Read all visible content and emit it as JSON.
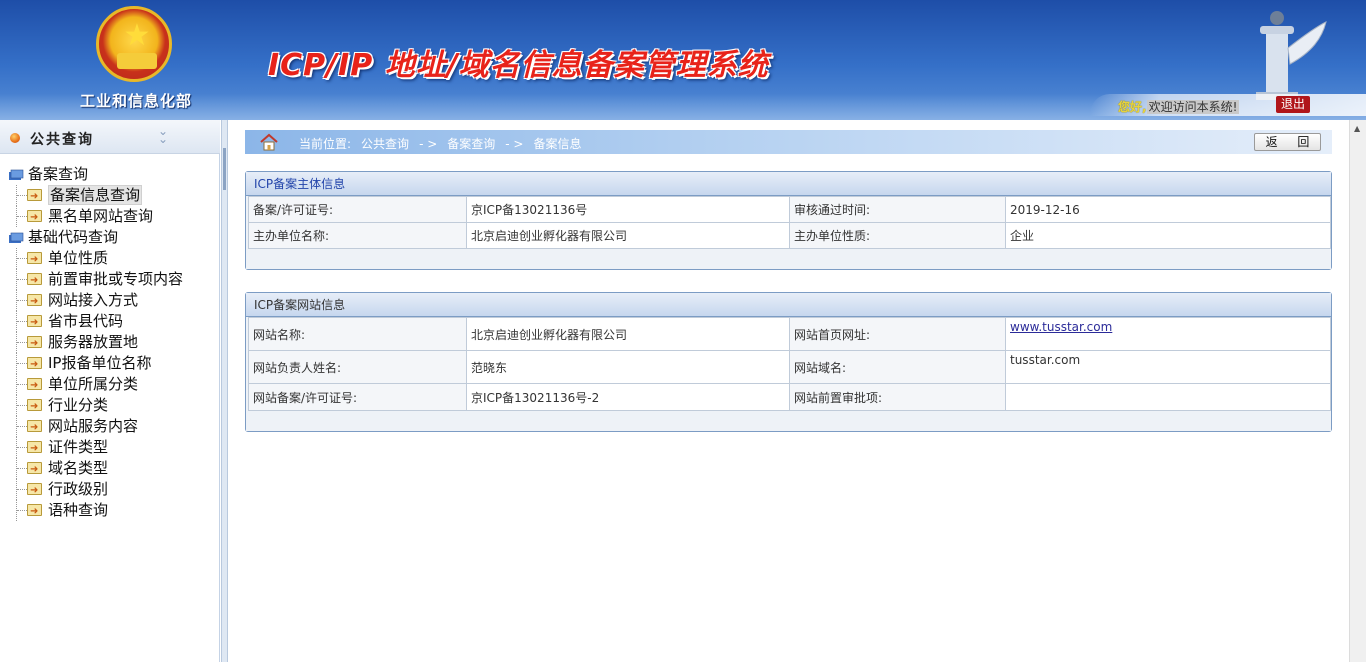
{
  "header": {
    "ministry": "工业和信息化部",
    "title": "ICP/IP 地址/域名信息备案管理系统",
    "greeting_hello": "您好,",
    "greeting_welcome": "欢迎访问本系统!",
    "logout_label": "退出"
  },
  "sidebar": {
    "section_title": "公共查询",
    "groups": [
      {
        "label": "备案查询",
        "items": [
          "备案信息查询",
          "黑名单网站查询"
        ]
      },
      {
        "label": "基础代码查询",
        "items": [
          "单位性质",
          "前置审批或专项内容",
          "网站接入方式",
          "省市县代码",
          "服务器放置地",
          "IP报备单位名称",
          "单位所属分类",
          "行业分类",
          "网站服务内容",
          "证件类型",
          "域名类型",
          "行政级别",
          "语种查询"
        ]
      }
    ],
    "active_item": "备案信息查询"
  },
  "breadcrumb": {
    "prefix": "当前位置:",
    "path": [
      "公共查询",
      "- >",
      "备案查询",
      "- >",
      "备案信息"
    ]
  },
  "back_label": "返 回",
  "subject_panel": {
    "title": "ICP备案主体信息",
    "rows": [
      [
        "备案/许可证号:",
        "京ICP备13021136号",
        "审核通过时间:",
        "2019-12-16"
      ],
      [
        "主办单位名称:",
        "北京启迪创业孵化器有限公司",
        "主办单位性质:",
        "企业"
      ]
    ]
  },
  "website_panel": {
    "title": "ICP备案网站信息",
    "rows": [
      [
        "网站名称:",
        "北京启迪创业孵化器有限公司",
        "网站首页网址:",
        "www.tusstar.com"
      ],
      [
        "网站负责人姓名:",
        "范晓东",
        "网站域名:",
        "tusstar.com"
      ],
      [
        "网站备案/许可证号:",
        "京ICP备13021136号-2",
        "网站前置审批项:",
        ""
      ]
    ]
  },
  "colors": {
    "header_blue": "#1e4ea8",
    "title_red": "#e8231a",
    "logout_red": "#b0151a",
    "panel_border": "#7c9cc4"
  }
}
